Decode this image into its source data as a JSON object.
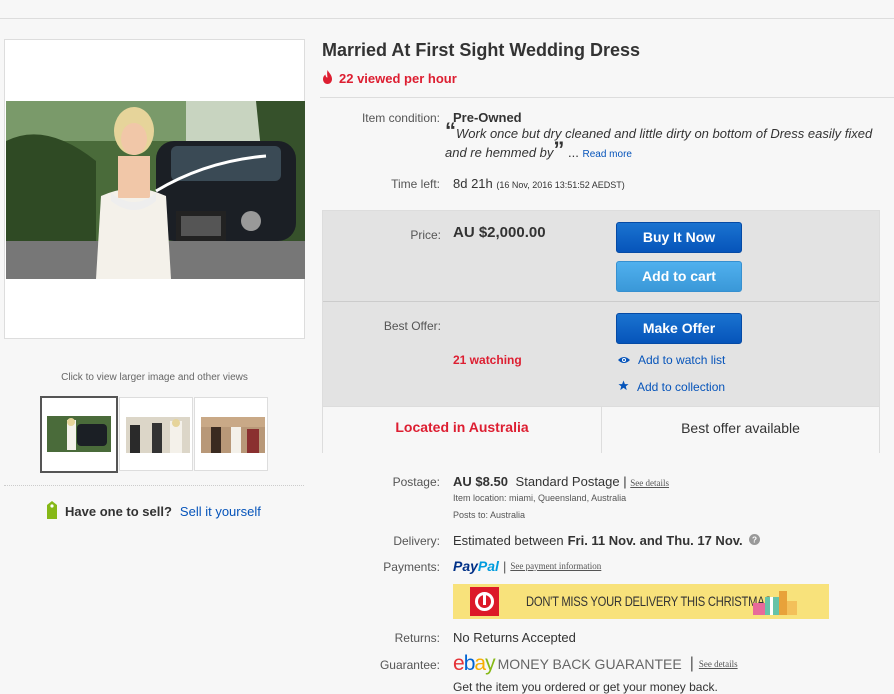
{
  "item": {
    "title": "Married At First Sight Wedding Dress",
    "viewed": "22 viewed per hour"
  },
  "images": {
    "caption": "Click to view larger image and other views"
  },
  "sell": {
    "prompt": "Have one to sell?",
    "link": "Sell it yourself"
  },
  "condition": {
    "label": "Item condition:",
    "value": "Pre-Owned",
    "quote": "Work once but dry cleaned and little dirty on bottom of Dress easily fixed and re hemmed by",
    "ellipsis": "...",
    "read_more": "Read more"
  },
  "time_left": {
    "label": "Time left:",
    "value": "8d 21h",
    "detail": "(16 Nov, 2016  13:51:52 AEDST)"
  },
  "price": {
    "label": "Price:",
    "value": "AU $2,000.00",
    "buy_now": "Buy It Now",
    "add_cart": "Add to cart"
  },
  "offer": {
    "label": "Best Offer:",
    "make_offer": "Make Offer",
    "watching": "21 watching",
    "watch_list": "Add to watch list",
    "collection": "Add to collection"
  },
  "location": {
    "located": "Located in Australia",
    "best_offer": "Best offer available"
  },
  "postage": {
    "label": "Postage:",
    "price": "AU $8.50",
    "method": "Standard Postage",
    "sep": "|",
    "see_details": "See details",
    "item_location": "Item location:  miami, Queensland, Australia",
    "posts_to": "Posts to:  Australia"
  },
  "delivery": {
    "label": "Delivery:",
    "prefix": "Estimated between",
    "dates": "Fri. 11 Nov. and Thu. 17 Nov."
  },
  "payments": {
    "label": "Payments:",
    "paypal_pay": "Pay",
    "paypal_pal": "Pal",
    "sep": "|",
    "see_payment": "See payment information",
    "banner_text": "DON'T MISS YOUR DELIVERY THIS CHRISTMAS"
  },
  "returns": {
    "label": "Returns:",
    "value": "No Returns Accepted"
  },
  "guarantee": {
    "label": "Guarantee:",
    "ebay_e": "e",
    "ebay_b": "b",
    "ebay_a": "a",
    "ebay_y": "y",
    "money_back": "MONEY BACK GUARANTEE",
    "sep": "|",
    "see_details": "See details",
    "tagline": "Get the item you ordered or get your money back."
  },
  "colors": {
    "ebay_red": "#e53238",
    "ebay_blue": "#0064d2",
    "ebay_yellow": "#f5af02",
    "ebay_green": "#86b817",
    "alert_red": "#dd1e31",
    "link_blue": "#0654ba"
  },
  "icons": [
    "flame-icon",
    "tag-icon",
    "eye-icon",
    "star-icon",
    "help-icon",
    "auspost-logo",
    "gift-icon"
  ]
}
